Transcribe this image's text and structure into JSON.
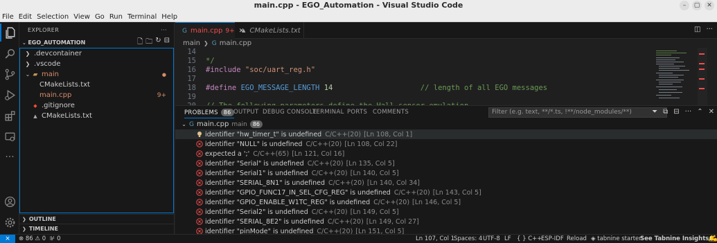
{
  "window": {
    "title": "main.cpp - EGO_Automation - Visual Studio Code",
    "controls": [
      "–",
      "▢",
      "✕"
    ]
  },
  "menu": [
    "File",
    "Edit",
    "Selection",
    "View",
    "Go",
    "Run",
    "Terminal",
    "Help"
  ],
  "activity_bar": [
    "files-icon",
    "search-icon",
    "source-control-icon",
    "run-debug-icon",
    "extensions-icon",
    "remote-explorer-icon",
    "more-icon",
    "account-icon",
    "settings-icon"
  ],
  "explorer": {
    "header": "EXPLORER",
    "more": "···",
    "project": "EGO_AUTOMATION",
    "items": [
      {
        "label": ".devcontainer",
        "kind": "folder",
        "open": false,
        "level": 0
      },
      {
        "label": ".vscode",
        "kind": "folder",
        "open": false,
        "level": 0
      },
      {
        "label": "main",
        "kind": "folder",
        "open": true,
        "level": 0,
        "status": "●"
      },
      {
        "label": "CMakeLists.txt",
        "kind": "file",
        "level": 1
      },
      {
        "label": "main.cpp",
        "kind": "file",
        "level": 1,
        "status": "9+"
      },
      {
        "label": ".gitignore",
        "kind": "file",
        "level": 0
      },
      {
        "label": "CMakeLists.txt",
        "kind": "file",
        "level": 0
      }
    ],
    "outline": "OUTLINE",
    "timeline": "TIMELINE"
  },
  "tabs": [
    {
      "label": "main.cpp",
      "badge": "9+",
      "close": "✕",
      "active": true
    },
    {
      "label": "CMakeLists.txt",
      "active": false
    }
  ],
  "breadcrumb": [
    "main",
    "main.cpp"
  ],
  "editor": {
    "lines": [
      {
        "num": "14",
        "parts": []
      },
      {
        "num": "15",
        "parts": [
          {
            "t": "*/",
            "c": "c-comment"
          }
        ]
      },
      {
        "num": "16",
        "parts": [
          {
            "t": "#include ",
            "c": "c-pre"
          },
          {
            "t": "\"soc/uart_reg.h\"",
            "c": "c-str"
          }
        ]
      },
      {
        "num": "17",
        "parts": []
      },
      {
        "num": "18",
        "parts": [
          {
            "t": "#define ",
            "c": "c-pre"
          },
          {
            "t": "EGO_MESSAGE_LENGTH",
            "c": "c-macro"
          },
          {
            "t": " ",
            "c": ""
          },
          {
            "t": "14",
            "c": "c-num"
          },
          {
            "t": "                    // length of all EGO messages",
            "c": "c-comment"
          }
        ]
      },
      {
        "num": "19",
        "parts": []
      },
      {
        "num": "20",
        "parts": [
          {
            "t": "// The following parameters define the Hall sensor emulation",
            "c": "c-comment"
          }
        ]
      }
    ]
  },
  "panel": {
    "tabs": [
      {
        "label": "PROBLEMS",
        "badge": "86",
        "active": true
      },
      {
        "label": "OUTPUT"
      },
      {
        "label": "DEBUG CONSOLE"
      },
      {
        "label": "TERMINAL"
      },
      {
        "label": "PORTS"
      },
      {
        "label": "COMMENTS"
      }
    ],
    "filter_placeholder": "Filter (e.g. text, **/*.ts, !**/node_modules/**)",
    "group": {
      "file": "main.cpp",
      "path": "main",
      "count": "86"
    },
    "problems": [
      {
        "severity": "info",
        "message": "identifier \"hw_timer_t\" is undefined",
        "source": "C/C++(20)",
        "location": "[Ln 108, Col 1]"
      },
      {
        "severity": "error",
        "message": "identifier \"NULL\" is undefined",
        "source": "C/C++(20)",
        "location": "[Ln 108, Col 22]"
      },
      {
        "severity": "error",
        "message": "expected a ';'",
        "source": "C/C++(65)",
        "location": "[Ln 121, Col 16]"
      },
      {
        "severity": "error",
        "message": "identifier \"Serial\" is undefined",
        "source": "C/C++(20)",
        "location": "[Ln 135, Col 5]"
      },
      {
        "severity": "error",
        "message": "identifier \"Serial1\" is undefined",
        "source": "C/C++(20)",
        "location": "[Ln 140, Col 5]"
      },
      {
        "severity": "error",
        "message": "identifier \"SERIAL_8N1\" is undefined",
        "source": "C/C++(20)",
        "location": "[Ln 140, Col 34]"
      },
      {
        "severity": "error",
        "message": "identifier \"GPIO_FUNC17_IN_SEL_CFG_REG\" is undefined",
        "source": "C/C++(20)",
        "location": "[Ln 143, Col 5]"
      },
      {
        "severity": "error",
        "message": "identifier \"GPIO_ENABLE_W1TC_REG\" is undefined",
        "source": "C/C++(20)",
        "location": "[Ln 146, Col 5]"
      },
      {
        "severity": "error",
        "message": "identifier \"Serial2\" is undefined",
        "source": "C/C++(20)",
        "location": "[Ln 149, Col 5]"
      },
      {
        "severity": "error",
        "message": "identifier \"SERIAL_8E2\" is undefined",
        "source": "C/C++(20)",
        "location": "[Ln 149, Col 27]"
      },
      {
        "severity": "error",
        "message": "identifier \"pinMode\" is undefined",
        "source": "C/C++(20)",
        "location": "[Ln 151, Col 5]"
      }
    ]
  },
  "status_bar": {
    "remote": "⨯",
    "errors": "86",
    "warnings": "0",
    "ports": "0",
    "cursor": "Ln 107, Col 1",
    "spaces": "Spaces: 4",
    "encoding": "UTF-8",
    "eol": "LF",
    "language": "{ } C++",
    "platform": "ESP-IDF",
    "reload": "Reload",
    "tabnine": "tabnine starter:",
    "insights": "See Tabnine Insights 💪",
    "colors": {
      "remote_bg": "#0078d4",
      "error": "#f14c4c",
      "modified": "#d68c6b"
    }
  }
}
